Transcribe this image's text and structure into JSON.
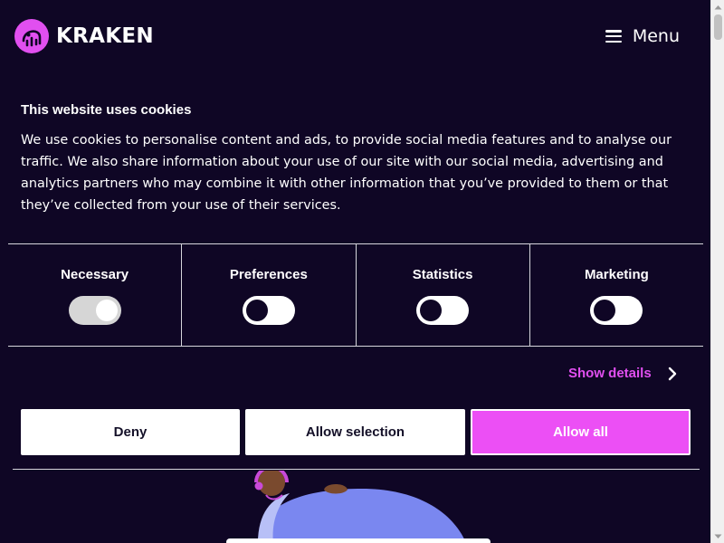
{
  "header": {
    "brand_name": "KRAKEN",
    "menu_label": "Menu",
    "brand_color": "#e14ff0"
  },
  "icons": {
    "logo": "kraken-squid-logo-icon",
    "menu": "hamburger-menu-icon",
    "details": "chevron-right-icon",
    "scroll_up": "arrow-up-icon",
    "scroll_down": "arrow-down-icon"
  },
  "cookie_banner": {
    "title": "This website uses cookies",
    "body": "We use cookies to personalise content and ads, to provide social media features and to analyse our traffic. We also share information about your use of our site with our social media, advertising and analytics partners who may combine it with other information that you’ve provided to them or that they’ve collected from your use of their services.",
    "categories": [
      {
        "label": "Necessary",
        "enabled": true,
        "locked": true
      },
      {
        "label": "Preferences",
        "enabled": false,
        "locked": false
      },
      {
        "label": "Statistics",
        "enabled": false,
        "locked": false
      },
      {
        "label": "Marketing",
        "enabled": false,
        "locked": false
      }
    ],
    "show_details_label": "Show details",
    "buttons": {
      "deny": "Deny",
      "allow_selection": "Allow selection",
      "allow_all": "Allow all"
    }
  },
  "colors": {
    "background": "#0f0625",
    "accent": "#ec4ff5",
    "link": "#e14ff0",
    "button_light": "#ffffff"
  }
}
